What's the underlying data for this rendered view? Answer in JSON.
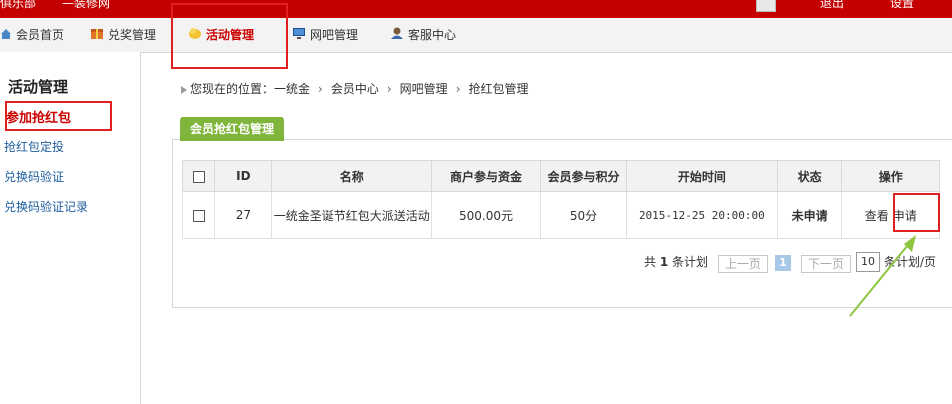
{
  "topbar": {
    "left_crumbs": [
      "俱乐部",
      "—装修网"
    ],
    "right_items": [
      "退出",
      "设置"
    ]
  },
  "nav": {
    "items": [
      {
        "label": "会员首页",
        "icon": "home-icon"
      },
      {
        "label": "兑奖管理",
        "icon": "gift-icon"
      },
      {
        "label": "活动管理",
        "icon": "hand-icon",
        "active": true
      },
      {
        "label": "网吧管理",
        "icon": "monitor-icon"
      },
      {
        "label": "客服中心",
        "icon": "service-icon"
      }
    ]
  },
  "sidebar": {
    "title": "活动管理",
    "items": [
      {
        "label": "参加抢红包",
        "active": true
      },
      {
        "label": "抢红包定投"
      },
      {
        "label": "兑换码验证"
      },
      {
        "label": "兑换码验证记录"
      }
    ]
  },
  "breadcrumb": {
    "prefix": "您现在的位置：",
    "items": [
      "一统金",
      "会员中心",
      "网吧管理",
      "抢红包管理"
    ],
    "separator": "›"
  },
  "panel": {
    "tab_label": "会员抢红包管理"
  },
  "table": {
    "headers": [
      "ID",
      "名称",
      "商户参与资金",
      "会员参与积分",
      "开始时间",
      "状态",
      "操作"
    ],
    "rows": [
      {
        "id": "27",
        "name": "一统金圣诞节红包大派送活动",
        "merchant_funds": "500.00元",
        "member_points": "50分",
        "start_time": "2015-12-25 20:00:00",
        "status": "未申请",
        "actions": [
          "查看",
          "申请"
        ]
      }
    ]
  },
  "pager": {
    "total_prefix": "共",
    "total_count": "1",
    "total_suffix": "条计划",
    "prev_label": "上一页",
    "current_page": "1",
    "next_label": "下一页",
    "page_size": "10",
    "page_size_suffix": "条计划/页"
  },
  "colors": {
    "brand_red": "#c40000",
    "tab_green": "#7fb53a",
    "highlight_red": "#e02020",
    "arrow_green": "#8cc63f"
  }
}
